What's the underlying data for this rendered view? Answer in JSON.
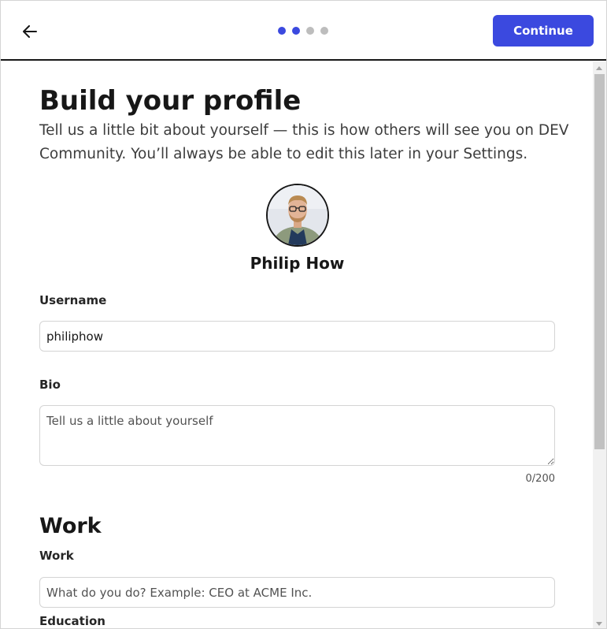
{
  "header": {
    "back_icon": "arrow-left-icon",
    "steps_total": 4,
    "steps_completed": 2,
    "continue_label": "Continue",
    "accent_color": "#3b49df"
  },
  "main": {
    "title": "Build your profile",
    "subtitle": "Tell us a little bit about yourself — this is how others will see you on DEV Community. You’ll always be able to edit this later in your Settings.",
    "profile": {
      "name": "Philip How"
    },
    "username": {
      "label": "Username",
      "value": "philiphow"
    },
    "bio": {
      "label": "Bio",
      "placeholder": "Tell us a little about yourself",
      "counter": "0/200"
    },
    "work_section": {
      "heading": "Work",
      "work": {
        "label": "Work",
        "placeholder": "What do you do? Example: CEO at ACME Inc."
      },
      "education": {
        "label": "Education"
      }
    }
  }
}
